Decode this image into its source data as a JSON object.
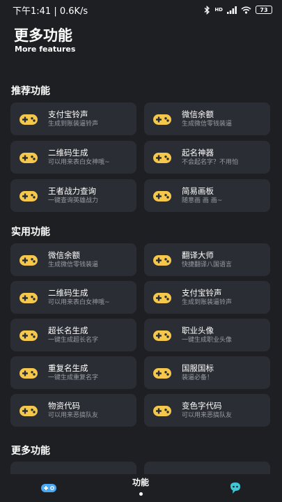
{
  "status_bar": {
    "time_speed": "下午1:41 | 0.6K/s",
    "network": "HD",
    "battery": "73"
  },
  "header": {
    "title": "更多功能",
    "subtitle": "More features"
  },
  "sections": {
    "recommended": {
      "title": "推荐功能",
      "items": [
        {
          "title": "支付宝铃声",
          "desc": "生成到账装逼铃声"
        },
        {
          "title": "微信余额",
          "desc": "生成微信零钱装逼"
        },
        {
          "title": "二维码生成",
          "desc": "可以用来表白女神哦~"
        },
        {
          "title": "起名神器",
          "desc": "不会起名字？不用怕"
        },
        {
          "title": "王者战力查询",
          "desc": "一键查询英雄战力"
        },
        {
          "title": "简易画板",
          "desc": "随意画 画 画~"
        }
      ]
    },
    "practical": {
      "title": "实用功能",
      "items": [
        {
          "title": "微信余额",
          "desc": "生成微信零钱装逼"
        },
        {
          "title": "翻译大师",
          "desc": "快捷翻译八国语言"
        },
        {
          "title": "二维码生成",
          "desc": "可以用来表白女神哦~"
        },
        {
          "title": "支付宝铃声",
          "desc": "生成到账装逼铃声"
        },
        {
          "title": "超长名生成",
          "desc": "一键生成超长名字"
        },
        {
          "title": "职业头像",
          "desc": "一键生成职业头像"
        },
        {
          "title": "重复名生成",
          "desc": "一键生成重复名字"
        },
        {
          "title": "国服国标",
          "desc": "装逼必备！"
        },
        {
          "title": "物资代码",
          "desc": "可以用来恶搞队友"
        },
        {
          "title": "变色字代码",
          "desc": "可以用来恶搞队友"
        }
      ]
    },
    "more": {
      "title": "更多功能"
    }
  },
  "bottom_nav": {
    "center_label": "功能",
    "left_icon": "gamepad-icon",
    "right_icon": "chat-bot-icon"
  },
  "colors": {
    "background": "#1d1f23",
    "card": "#2a2d33",
    "gamepad_yellow": "#f5c74a",
    "nav_left_icon": "#4aa8f5",
    "nav_right_icon": "#3fc7d6"
  }
}
